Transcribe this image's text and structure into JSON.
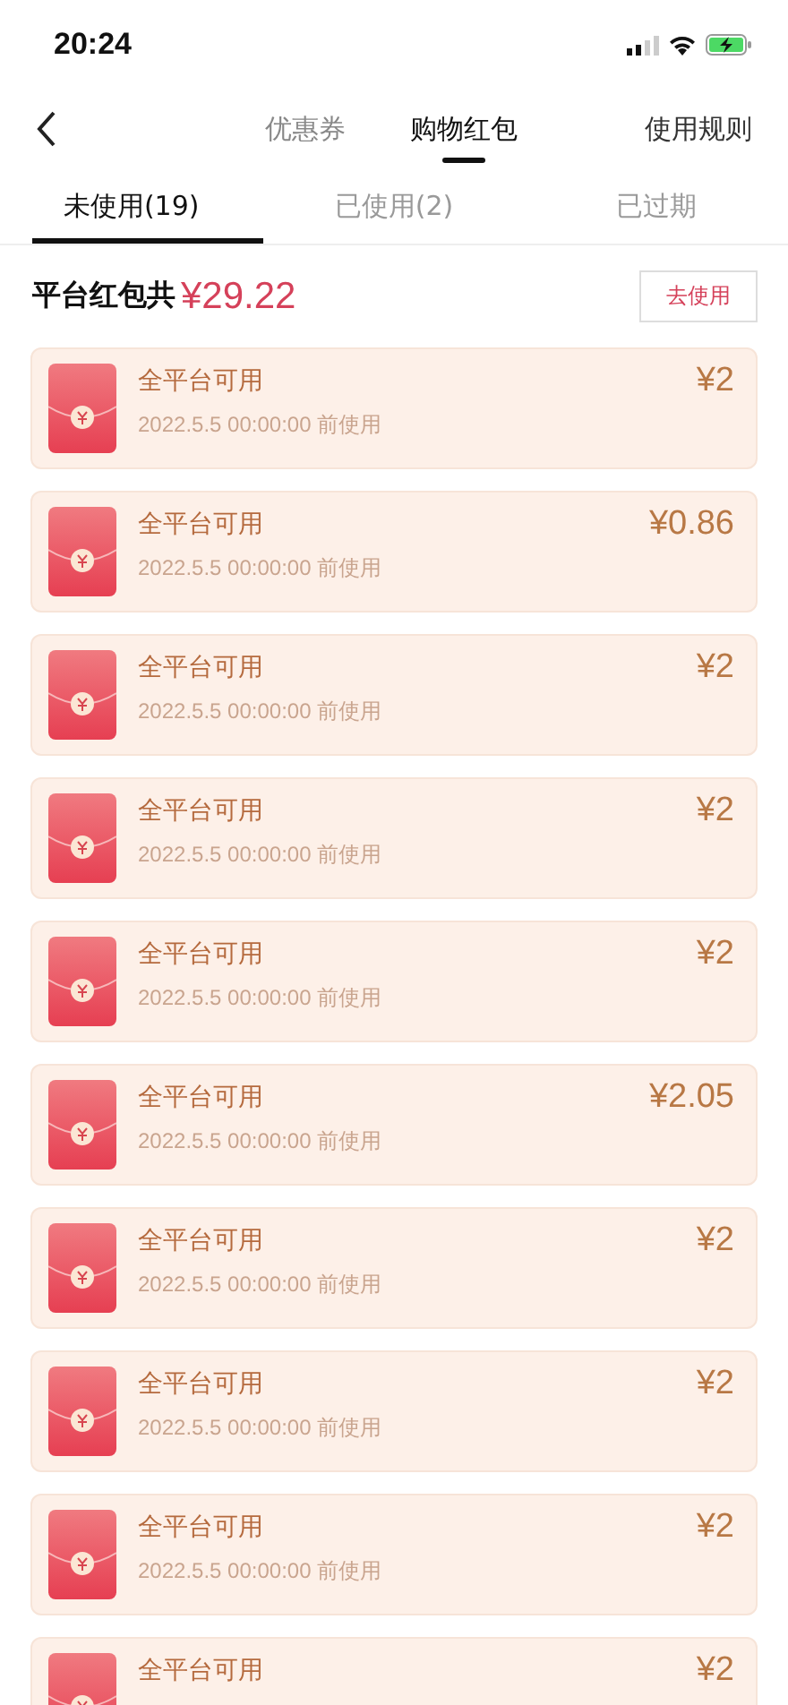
{
  "status_bar": {
    "time": "20:24"
  },
  "nav": {
    "tabs": [
      {
        "label": "优惠券",
        "selected": false
      },
      {
        "label": "购物红包",
        "selected": true
      }
    ],
    "rules_link": "使用规则"
  },
  "sub_tabs": [
    {
      "label": "未使用(19)",
      "selected": true
    },
    {
      "label": "已使用(2)",
      "selected": false
    },
    {
      "label": "已过期",
      "selected": false
    }
  ],
  "summary": {
    "label": "平台红包共",
    "total": "¥29.22",
    "button": "去使用"
  },
  "packets": [
    {
      "title": "全平台可用",
      "date": "2022.5.5 00:00:00 前使用",
      "amount": "¥2"
    },
    {
      "title": "全平台可用",
      "date": "2022.5.5 00:00:00 前使用",
      "amount": "¥0.86"
    },
    {
      "title": "全平台可用",
      "date": "2022.5.5 00:00:00 前使用",
      "amount": "¥2"
    },
    {
      "title": "全平台可用",
      "date": "2022.5.5 00:00:00 前使用",
      "amount": "¥2"
    },
    {
      "title": "全平台可用",
      "date": "2022.5.5 00:00:00 前使用",
      "amount": "¥2"
    },
    {
      "title": "全平台可用",
      "date": "2022.5.5 00:00:00 前使用",
      "amount": "¥2.05"
    },
    {
      "title": "全平台可用",
      "date": "2022.5.5 00:00:00 前使用",
      "amount": "¥2"
    },
    {
      "title": "全平台可用",
      "date": "2022.5.5 00:00:00 前使用",
      "amount": "¥2"
    },
    {
      "title": "全平台可用",
      "date": "2022.5.5 00:00:00 前使用",
      "amount": "¥2"
    },
    {
      "title": "全平台可用",
      "amount": "¥2"
    }
  ]
}
